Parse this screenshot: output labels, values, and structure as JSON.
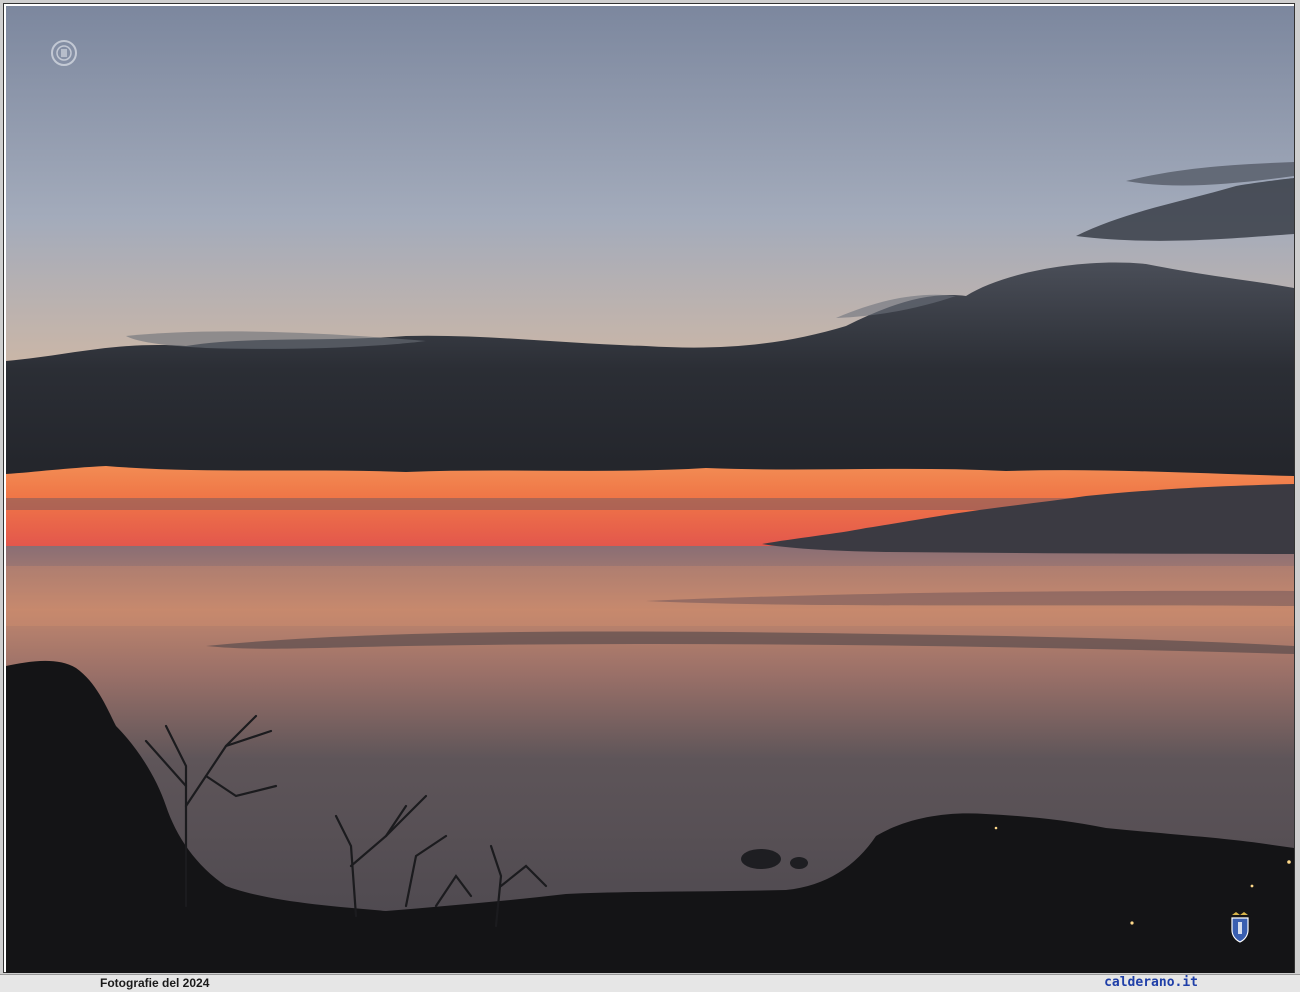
{
  "footer": {
    "caption": "Fotografie del 2024",
    "site": "calderano.it"
  },
  "photo": {
    "subject": "sunset-over-sea",
    "colors": {
      "sky_top": "#7f8aa0",
      "sky_mid": "#a3acbb",
      "horizon_glow": "#f07a4a",
      "horizon_red": "#e35a4a",
      "cloud_dark": "#2c2f36",
      "sea": "#5a545a",
      "sea_reflection": "#c88a70",
      "silhouette": "#141416",
      "site_link": "#1f3fa8"
    },
    "icons": [
      "watermark-seal-icon",
      "coat-of-arms-icon"
    ]
  }
}
